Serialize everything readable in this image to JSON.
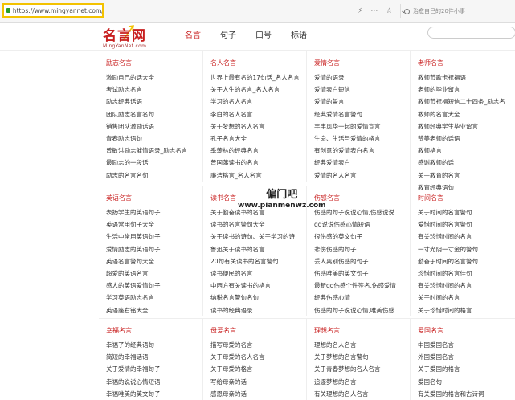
{
  "browser": {
    "url": "https://www.mingyannet.com/",
    "search_placeholder": "治愈自己的20件小事",
    "icons": [
      "lightning-icon",
      "more-icon",
      "star-icon",
      "chevron-down-icon"
    ]
  },
  "site": {
    "logo_text": "名言网",
    "logo_sub": "MingYanNet.com",
    "nav": [
      "名言",
      "句子",
      "口号",
      "标语"
    ]
  },
  "watermark": {
    "main": "偏门吧",
    "sub": "www.pianmenwz.com"
  },
  "sections": [
    {
      "title": "励志名言",
      "items": [
        "激励自己的话大全",
        "考试励志名言",
        "励志经典话语",
        "团队励志名言名句",
        "销售团队激励话语",
        "青春励志语句",
        "曾敏洪励志催情语录_励志名言",
        "最励志的一段话",
        "励志的名言名句"
      ]
    },
    {
      "title": "名人名言",
      "items": [
        "世界上最有名的17句话_名人名言",
        "关于人生的名言_名人名言",
        "学习的名人名言",
        "李白的名人名言",
        "关于梦想的名人名言",
        "孔子名言大全",
        "季羡林的经典名言",
        "曾国藩读书的名言",
        "廉洁格言_名人名言"
      ]
    },
    {
      "title": "爱情名言",
      "items": [
        "爱情的语录",
        "爱情表白短信",
        "爱情的誓言",
        "经典爱情名言警句",
        "丰丰风华一起的爱情宣言",
        "生命、生活与爱情的格言",
        "有创意的爱情表白名言",
        "经典爱情表白",
        "爱情的名人名言"
      ]
    },
    {
      "title": "老师名言",
      "items": [
        "教师节歌卡祝福语",
        "老师的毕业留言",
        "教师节祝福短信二十四条_励志名",
        "教师的名言大全",
        "教师经典学生毕业留言",
        "赞美老师的话语",
        "教师格言",
        "感谢教师的话",
        "关于教育的名言",
        "教育经典语句"
      ]
    },
    {
      "title": "英语名言",
      "items": [
        "表扬学生的英语句子",
        "英语常用句子大全",
        "生活中常用英语句子",
        "爱情励志的英语句子",
        "英语名言警句大全",
        "超爱的英语名言",
        "感人的英语爱情句子",
        "学习英语励志名言",
        "英语座右铭大全"
      ]
    },
    {
      "title": "读书名言",
      "items": [
        "关于勤奋读书的名言",
        "读书的名言警句大全",
        "关于读书的诗句、关于学习的诗",
        "鲁迅关于读书的名言",
        "20句有关读书的名言警句",
        "读书便民的名言",
        "中西方有关读书的格言",
        "纳税名言警句名句",
        "读书的经典语录"
      ]
    },
    {
      "title": "伤感名言",
      "items": [
        "伤感的句子说说心情,伤感说说",
        "qq说说伤感心情短语",
        "很伤感的英文句子",
        "悲伤伤感的句子",
        "丢人离别伤感的句子",
        "伤感唯美的英文句子",
        "最新qq伤感个性签名,伤感爱情",
        "经典伤感心情",
        "伤感的句子说说心情,唯美伤感"
      ]
    },
    {
      "title": "时间名言",
      "items": [
        "关于时间的名言警句",
        "爱惜时间的名言警句",
        "有关珍惜时间的名言",
        "一寸光阴一寸金的警句",
        "勤奋于时间的名言警句",
        "珍惜时间的名言佳句",
        "有关珍惜时间的名言",
        "关于时间的名言",
        "关于珍惜时间的格言"
      ]
    },
    {
      "title": "幸福名言",
      "items": [
        "幸福了的经典语句",
        "简短的幸福话语",
        "关于爱情的幸福句子",
        "幸福的说说心情短语",
        "幸福唯美的英文句子"
      ]
    },
    {
      "title": "母爱名言",
      "items": [
        "描写母爱的名言",
        "关于母爱的名人名言",
        "关于母爱的格言",
        "写给母亲的话",
        "感恩母亲的话"
      ]
    },
    {
      "title": "理想名言",
      "items": [
        "理想的名人名言",
        "关于梦想的名言警句",
        "关于青春梦想的名人名言",
        "追逐梦想的名言",
        "有关理想的名人名言"
      ]
    },
    {
      "title": "爱国名言",
      "items": [
        "中国爱国名言",
        "外国爱国名言",
        "关于爱国的格言",
        "爱国名句",
        "有关爱国的格言和古诗词"
      ]
    }
  ]
}
